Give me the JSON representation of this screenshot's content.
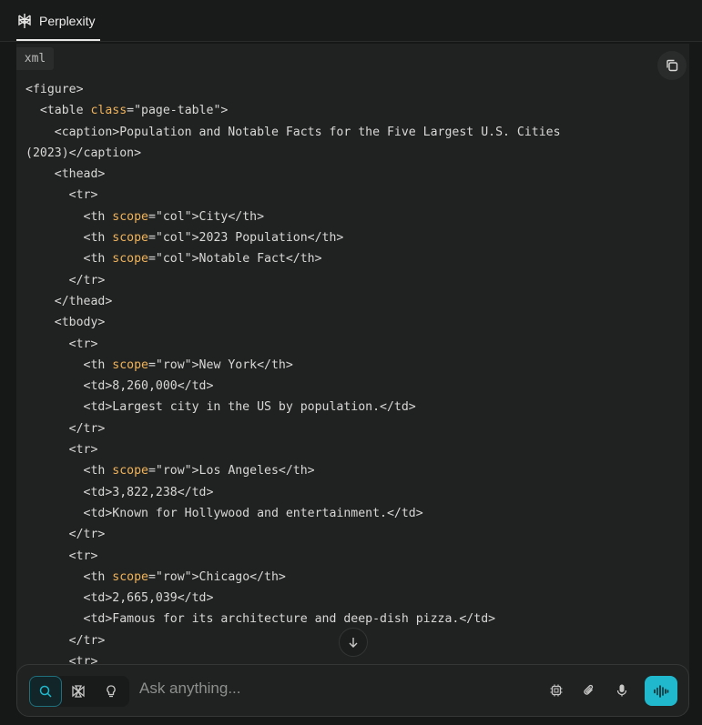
{
  "tab": {
    "title": "Perplexity"
  },
  "code": {
    "language": "xml",
    "lines": [
      [
        {
          "t": "<figure>"
        }
      ],
      [
        {
          "t": "  <table "
        },
        {
          "t": "class",
          "a": 1
        },
        {
          "t": "=\"page-table\">"
        }
      ],
      [
        {
          "t": "    <caption>Population and Notable Facts for the Five Largest U.S. Cities"
        }
      ],
      [
        {
          "t": "(2023)</caption>"
        }
      ],
      [
        {
          "t": "    <thead>"
        }
      ],
      [
        {
          "t": "      <tr>"
        }
      ],
      [
        {
          "t": "        <th "
        },
        {
          "t": "scope",
          "a": 1
        },
        {
          "t": "=\"col\">City</th>"
        }
      ],
      [
        {
          "t": "        <th "
        },
        {
          "t": "scope",
          "a": 1
        },
        {
          "t": "=\"col\">2023 Population</th>"
        }
      ],
      [
        {
          "t": "        <th "
        },
        {
          "t": "scope",
          "a": 1
        },
        {
          "t": "=\"col\">Notable Fact</th>"
        }
      ],
      [
        {
          "t": "      </tr>"
        }
      ],
      [
        {
          "t": "    </thead>"
        }
      ],
      [
        {
          "t": "    <tbody>"
        }
      ],
      [
        {
          "t": "      <tr>"
        }
      ],
      [
        {
          "t": "        <th "
        },
        {
          "t": "scope",
          "a": 1
        },
        {
          "t": "=\"row\">New York</th>"
        }
      ],
      [
        {
          "t": "        <td>8,260,000</td>"
        }
      ],
      [
        {
          "t": "        <td>Largest city in the US by population.</td>"
        }
      ],
      [
        {
          "t": "      </tr>"
        }
      ],
      [
        {
          "t": "      <tr>"
        }
      ],
      [
        {
          "t": "        <th "
        },
        {
          "t": "scope",
          "a": 1
        },
        {
          "t": "=\"row\">Los Angeles</th>"
        }
      ],
      [
        {
          "t": "        <td>3,822,238</td>"
        }
      ],
      [
        {
          "t": "        <td>Known for Hollywood and entertainment.</td>"
        }
      ],
      [
        {
          "t": "      </tr>"
        }
      ],
      [
        {
          "t": "      <tr>"
        }
      ],
      [
        {
          "t": "        <th "
        },
        {
          "t": "scope",
          "a": 1
        },
        {
          "t": "=\"row\">Chicago</th>"
        }
      ],
      [
        {
          "t": "        <td>2,665,039</td>"
        }
      ],
      [
        {
          "t": "        <td>Famous for its architecture and deep-dish pizza.</td>"
        }
      ],
      [
        {
          "t": "      </tr>"
        }
      ],
      [
        {
          "t": "      <tr>"
        }
      ]
    ]
  },
  "input": {
    "placeholder": "Ask anything..."
  },
  "icons": {
    "logo": "perplexity-logo-icon",
    "copy": "copy-icon",
    "scroll": "arrow-down-icon",
    "search": "search-icon",
    "research": "research-icon",
    "labs": "lightbulb-icon",
    "model": "chip-icon",
    "attach": "paperclip-icon",
    "mic": "microphone-icon",
    "voice": "voice-waveform-icon"
  },
  "colors": {
    "accent": "#20b8cd",
    "attribute": "#f0b35a",
    "background": "#161818",
    "code_bg": "#202222"
  }
}
